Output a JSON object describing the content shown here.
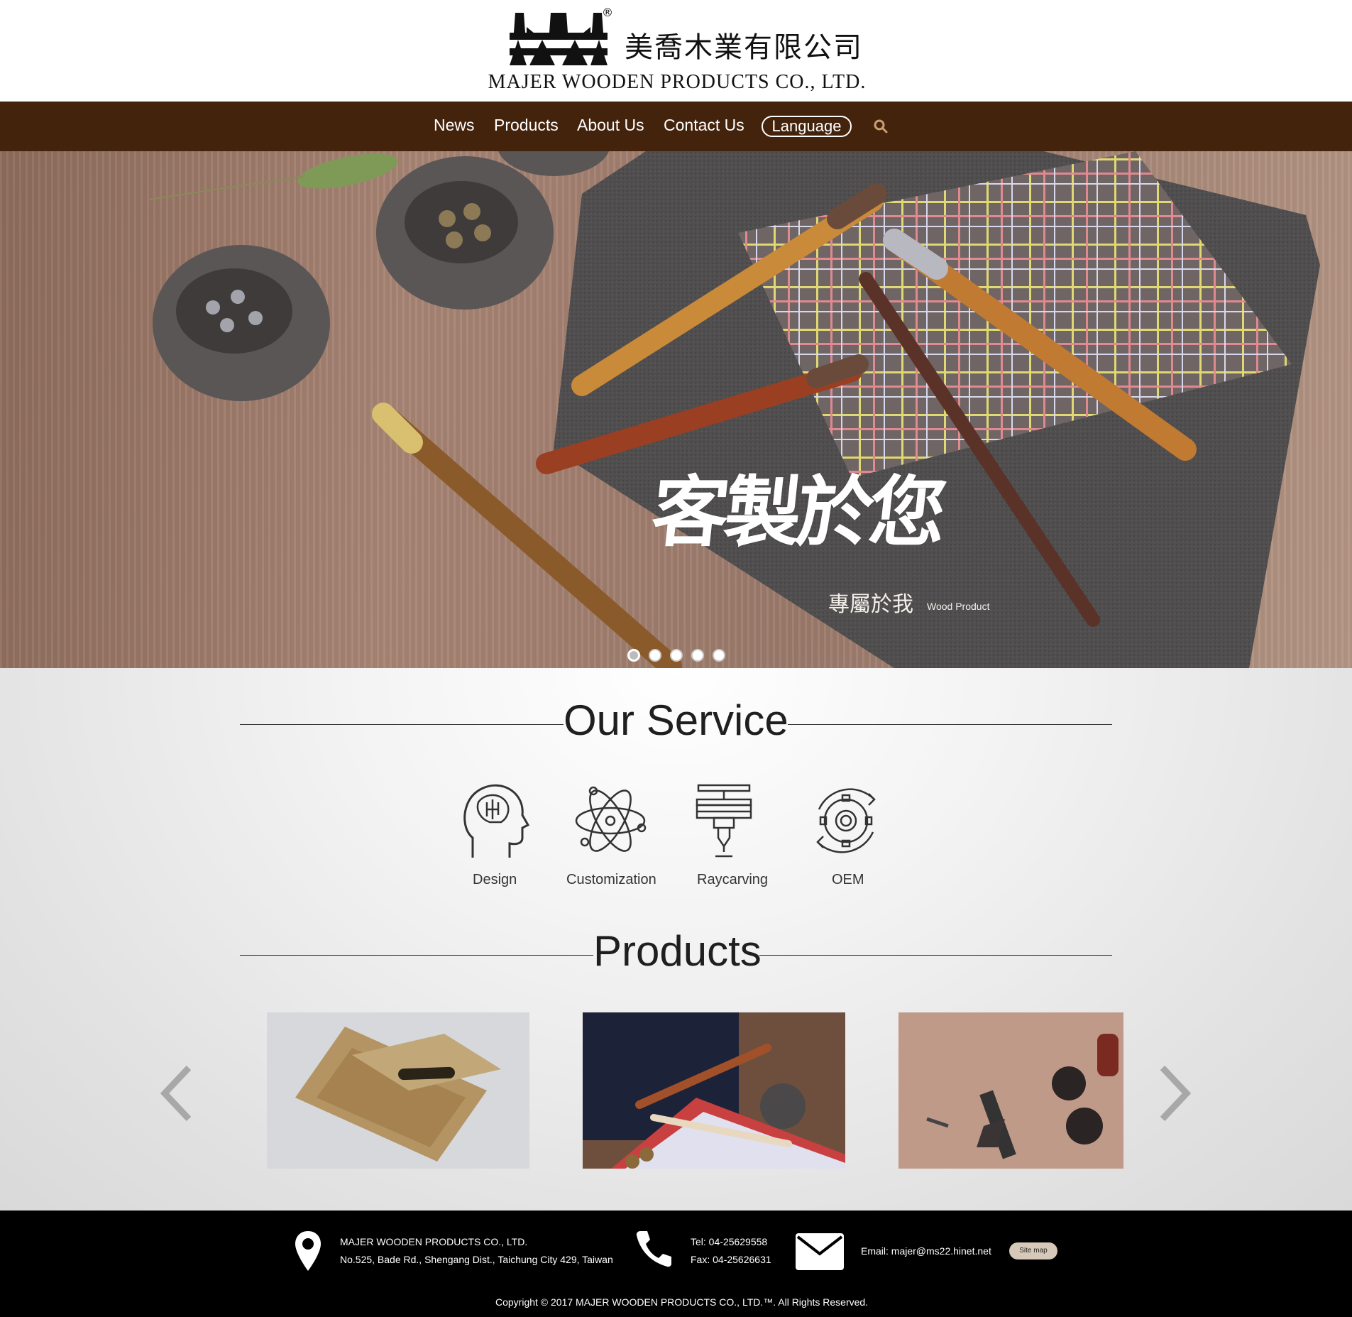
{
  "brand": {
    "registered": "®",
    "name_cn": "美喬木業有限公司",
    "name_en": "MAJER WOODEN PRODUCTS CO., LTD."
  },
  "nav": {
    "items": [
      "News",
      "Products",
      "About Us",
      "Contact Us"
    ],
    "language": "Language",
    "search_icon": "search-icon"
  },
  "hero": {
    "headline": "客製於您",
    "subline": "專屬於我",
    "subline_en": "Wood Product",
    "slide_count": 5,
    "active_slide": 1
  },
  "service": {
    "title": "Our Service",
    "items": [
      {
        "label": "Design",
        "icon": "brain-head-icon"
      },
      {
        "label": "Customization",
        "icon": "atom-icon"
      },
      {
        "label": "Raycarving",
        "icon": "engraver-icon"
      },
      {
        "label": "OEM",
        "icon": "gear-cycle-icon"
      }
    ]
  },
  "products": {
    "title": "Products",
    "items": [
      {
        "alt": "kraft paper pen box"
      },
      {
        "alt": "wooden pens on striped cloth"
      },
      {
        "alt": "wooden keychains and bookmarks"
      }
    ],
    "prev_icon": "chevron-left-icon",
    "next_icon": "chevron-right-icon"
  },
  "footer": {
    "company": "MAJER WOODEN PRODUCTS CO., LTD.",
    "address": "No.525, Bade Rd., Shengang Dist., Taichung City 429, Taiwan",
    "tel": "Tel: 04-25629558",
    "fax": "Fax: 04-25626631",
    "email": "Email: majer@ms22.hinet.net",
    "sitemap": "Site map",
    "copyright": "Copyright © 2017 MAJER WOODEN PRODUCTS CO., LTD.™. All Rights Reserved."
  },
  "colors": {
    "nav_bg": "#44230d",
    "footer_bg": "#000000",
    "accent_search": "#c8a070"
  }
}
